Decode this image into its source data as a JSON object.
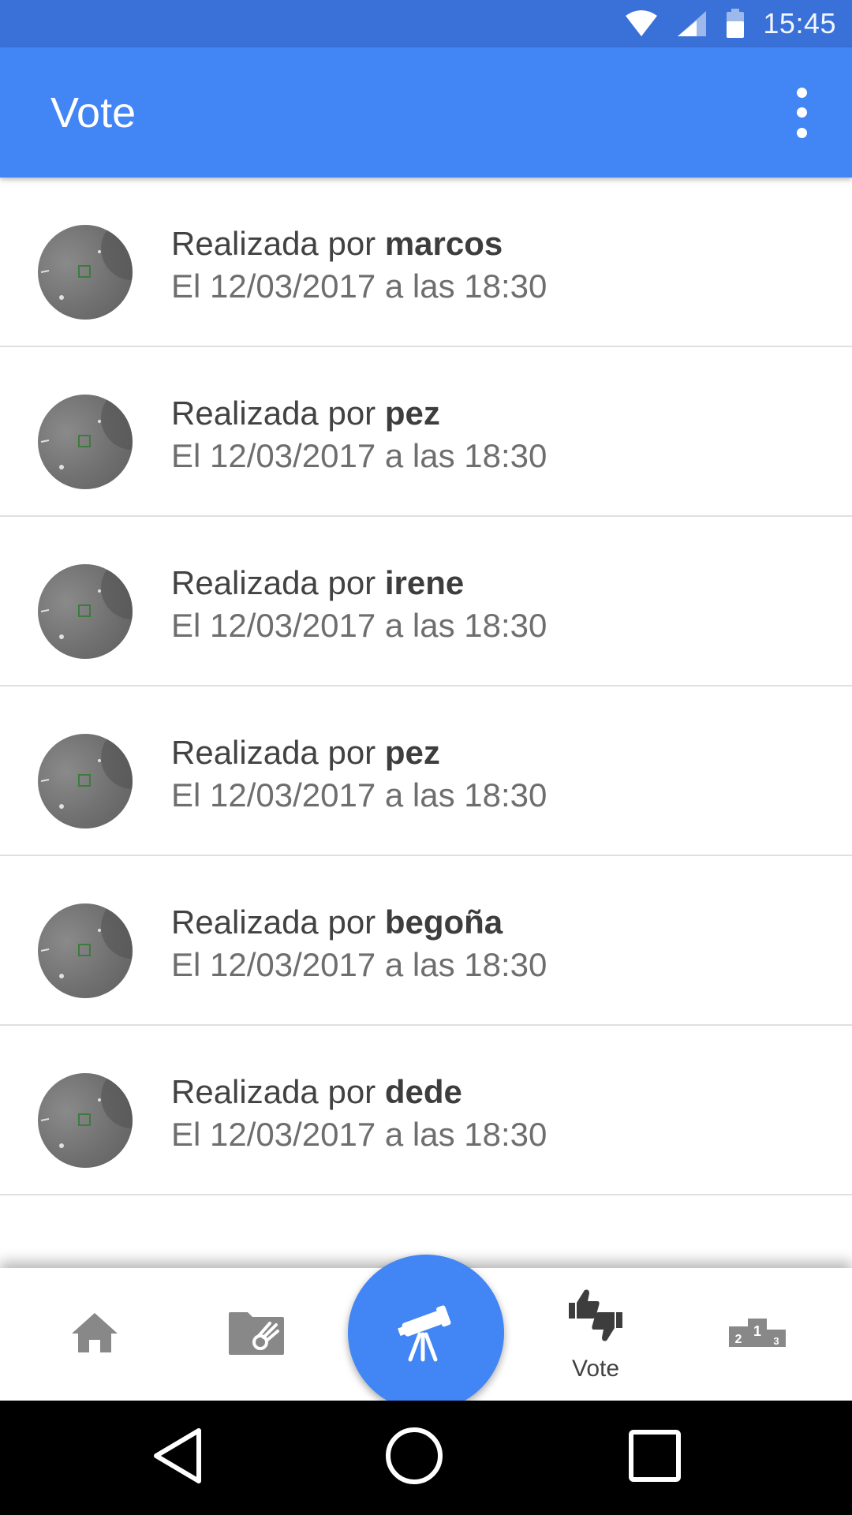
{
  "status_bar": {
    "time": "15:45",
    "icons": [
      "wifi-icon",
      "signal-icon",
      "battery-icon"
    ]
  },
  "app_bar": {
    "title": "Vote",
    "menu_icon": "overflow-menu-icon"
  },
  "list": {
    "items": [
      {
        "prefix": "Realizada por ",
        "user": "marcos",
        "date": "El 12/03/2017 a las 18:30"
      },
      {
        "prefix": "Realizada por ",
        "user": "pez",
        "date": "El 12/03/2017 a las 18:30"
      },
      {
        "prefix": "Realizada por ",
        "user": "irene",
        "date": "El 12/03/2017 a las 18:30"
      },
      {
        "prefix": "Realizada por ",
        "user": "pez",
        "date": "El 12/03/2017 a las 18:30"
      },
      {
        "prefix": "Realizada por ",
        "user": "begoña",
        "date": "El 12/03/2017 a las 18:30"
      },
      {
        "prefix": "Realizada por ",
        "user": "dede",
        "date": "El 12/03/2017 a las 18:30"
      }
    ]
  },
  "bottom_nav": {
    "items": [
      {
        "icon": "home-icon",
        "label": ""
      },
      {
        "icon": "gallery-folder-icon",
        "label": ""
      },
      {
        "icon": "telescope-icon",
        "label": ""
      },
      {
        "icon": "thumbs-vote-icon",
        "label": "Vote"
      },
      {
        "icon": "ranking-podium-icon",
        "label": ""
      }
    ],
    "podium_numbers": [
      "2",
      "1",
      "3"
    ]
  },
  "colors": {
    "status_bar": "#3a71d8",
    "app_bar": "#4285f4",
    "fab": "#4285f4",
    "system_nav": "#000000"
  },
  "system_nav": {
    "icons": [
      "back-icon",
      "home-circle-icon",
      "recent-apps-icon"
    ]
  }
}
